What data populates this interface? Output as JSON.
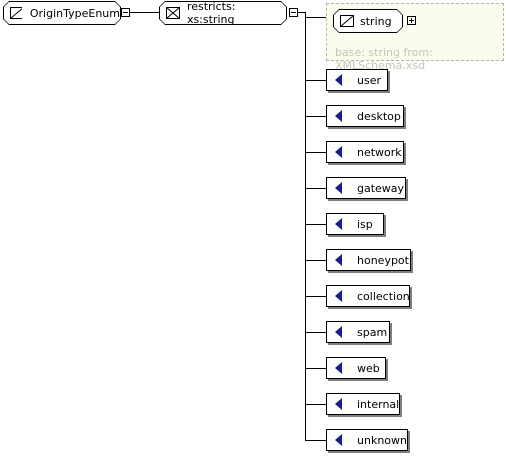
{
  "root": {
    "label": "OriginTypeEnum",
    "icon": "simple-type-icon"
  },
  "restriction": {
    "label": "restricts: xs:string",
    "icon": "restriction-icon"
  },
  "base": {
    "label": "string",
    "note": "base: string from: XMLSchema.xsd",
    "icon": "simple-type-icon"
  },
  "enumerations": [
    {
      "label": "user"
    },
    {
      "label": "desktop"
    },
    {
      "label": "network"
    },
    {
      "label": "gateway"
    },
    {
      "label": "isp"
    },
    {
      "label": "honeypot"
    },
    {
      "label": "collection"
    },
    {
      "label": "spam"
    },
    {
      "label": "web"
    },
    {
      "label": "internal"
    },
    {
      "label": "unknown"
    }
  ],
  "colors": {
    "enum_marker": "#1a1aa8",
    "base_panel_bg": "#fbfbee",
    "base_note_text": "#c5c5b7"
  }
}
